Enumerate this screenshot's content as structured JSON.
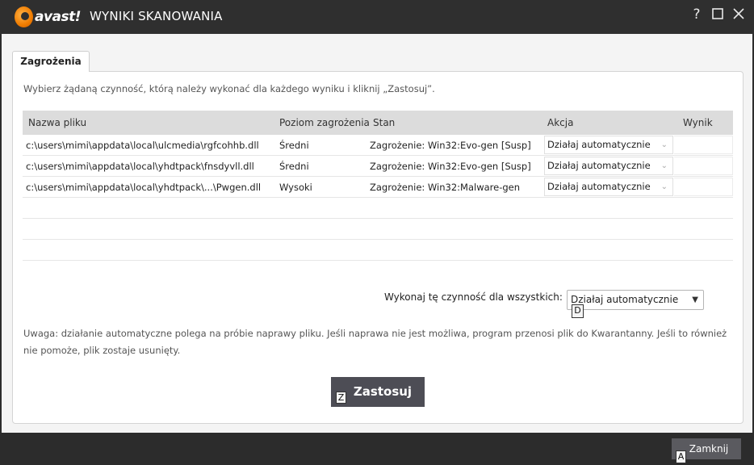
{
  "window": {
    "logo_text": "avast!",
    "title": "WYNIKI SKANOWANIA",
    "help_label": "?"
  },
  "tab": {
    "label": "Zagrożenia"
  },
  "instruction": "Wybierz żądaną czynność, którą należy wykonać dla każdego wyniku i kliknij „Zastosuj”.",
  "table": {
    "headers": {
      "filename": "Nazwa pliku",
      "level": "Poziom zagrożenia",
      "status": "Stan",
      "action": "Akcja",
      "result": "Wynik"
    },
    "rows": [
      {
        "filename": "c:\\users\\mimi\\appdata\\local\\ulcmedia\\rgfcohhb.dll",
        "level": "Średni",
        "status": "Zagrożenie: Win32:Evo-gen [Susp]",
        "action": "Działaj automatycznie",
        "result": ""
      },
      {
        "filename": "c:\\users\\mimi\\appdata\\local\\yhdtpack\\fnsdyvll.dll",
        "level": "Średni",
        "status": "Zagrożenie: Win32:Evo-gen [Susp]",
        "action": "Działaj automatycznie",
        "result": ""
      },
      {
        "filename": "c:\\users\\mimi\\appdata\\local\\yhdtpack\\...\\Pwgen.dll",
        "level": "Wysoki",
        "status": "Zagrożenie: Win32:Malware-gen",
        "action": "Działaj automatycznie",
        "result": ""
      }
    ]
  },
  "apply_all": {
    "label": "Wykonaj tę czynność dla wszystkich:",
    "value": "Działaj automatycznie",
    "key_hint": "D"
  },
  "note": "Uwaga: działanie automatyczne polega na próbie naprawy pliku. Jeśli naprawa nie jest możliwa, program przenosi plik do Kwarantanny. Jeśli to również nie pomoże, plik zostaje usunięty.",
  "apply_button": {
    "label": "Zastosuj",
    "key_hint": "Z"
  },
  "close_button": {
    "label": "Zamknij",
    "key_hint": "A"
  },
  "colors": {
    "titlebar_bg": "#2f2f2f",
    "brand_orange": "#f07c00",
    "header_bg": "#dcdcdc",
    "button_bg": "#4d4d55"
  }
}
